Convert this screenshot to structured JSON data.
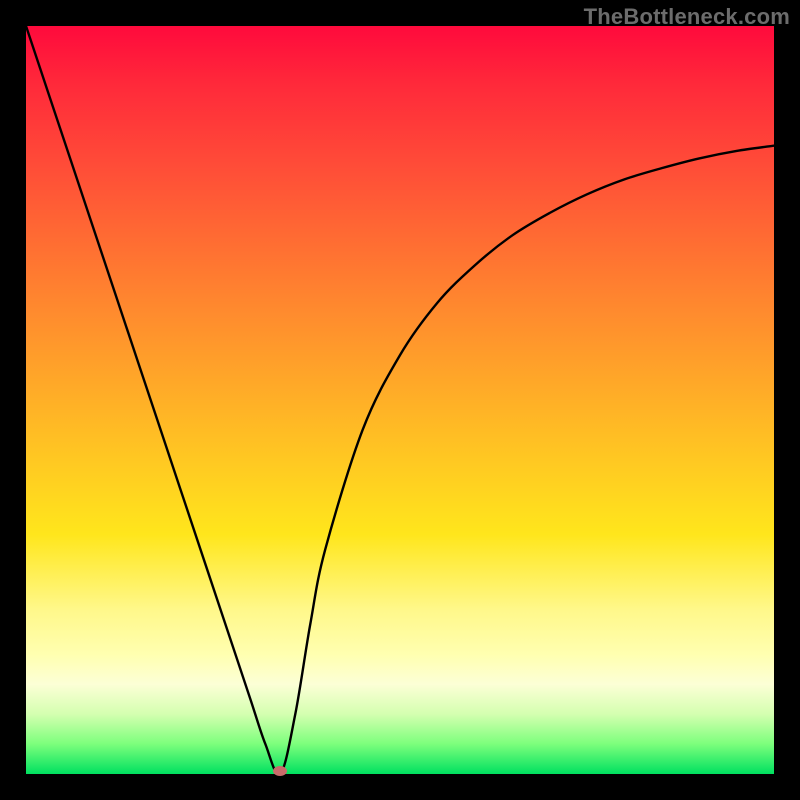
{
  "watermark": "TheBottleneck.com",
  "colors": {
    "frame": "#000000",
    "curve": "#000000",
    "marker": "#c96a6a",
    "gradient_top": "#ff0a3c",
    "gradient_bottom": "#00e060"
  },
  "chart_data": {
    "type": "line",
    "title": "",
    "xlabel": "",
    "ylabel": "",
    "xlim": [
      0,
      100
    ],
    "ylim": [
      0,
      100
    ],
    "grid": false,
    "legend": false,
    "series": [
      {
        "name": "bottleneck-curve",
        "x": [
          0,
          3,
          6,
          9,
          12,
          15,
          18,
          21,
          24,
          27,
          30,
          32,
          34,
          36,
          38,
          40,
          45,
          50,
          55,
          60,
          65,
          70,
          75,
          80,
          85,
          90,
          95,
          100
        ],
        "y": [
          100,
          91,
          82,
          73,
          64,
          55,
          46,
          37,
          28,
          19,
          10,
          4,
          0,
          8,
          20,
          30,
          46,
          56,
          63,
          68,
          72,
          75,
          77.5,
          79.5,
          81,
          82.3,
          83.3,
          84
        ]
      }
    ],
    "marker": {
      "x": 34,
      "y": 0
    },
    "background_gradient": {
      "direction": "top-to-bottom",
      "stops": [
        {
          "pos": 0,
          "color": "#ff0a3c"
        },
        {
          "pos": 0.38,
          "color": "#ff8a2e"
        },
        {
          "pos": 0.68,
          "color": "#ffe61c"
        },
        {
          "pos": 0.88,
          "color": "#fcffd6"
        },
        {
          "pos": 1.0,
          "color": "#00e060"
        }
      ]
    }
  }
}
